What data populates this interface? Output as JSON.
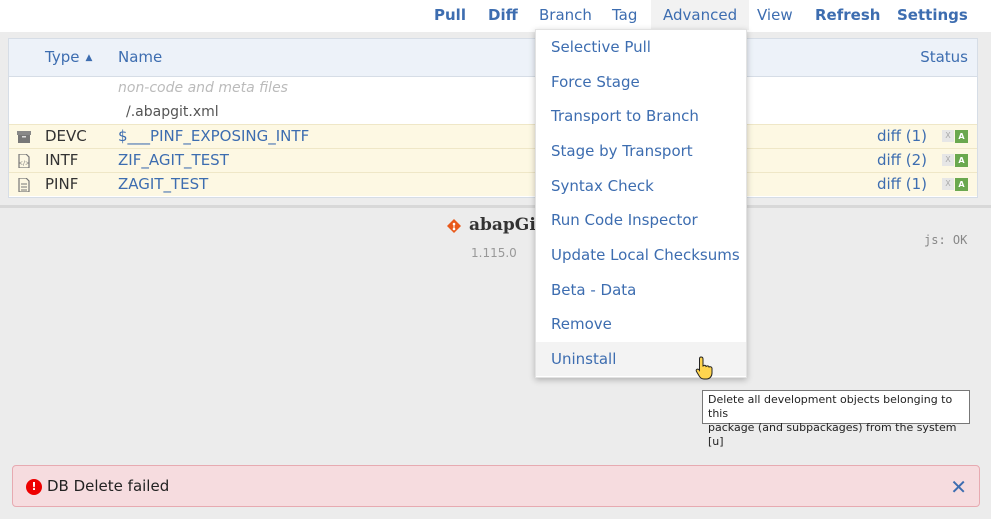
{
  "topnav": {
    "pull": "Pull",
    "diff": "Diff",
    "branch": "Branch",
    "tag": "Tag",
    "advanced": "Advanced",
    "view": "View",
    "refresh": "Refresh",
    "settings": "Settings"
  },
  "table": {
    "headers": {
      "type": "Type",
      "sort_indicator": "▲",
      "name": "Name",
      "status": "Status"
    },
    "meta": {
      "label": "non-code and meta files",
      "file": "/.abapgit.xml"
    },
    "rows": [
      {
        "icon": "package-icon",
        "type": "DEVC",
        "name": "$___PINF_EXPOSING_INTF",
        "diff": "diff (1)",
        "badge_x": "X",
        "badge_a": "A"
      },
      {
        "icon": "code-file-icon",
        "type": "INTF",
        "name": "ZIF_AGIT_TEST",
        "diff": "diff (2)",
        "badge_x": "X",
        "badge_a": "A"
      },
      {
        "icon": "document-icon",
        "type": "PINF",
        "name": "ZAGIT_TEST",
        "diff": "diff (1)",
        "badge_x": "X",
        "badge_a": "A"
      }
    ]
  },
  "advanced_menu": {
    "items": [
      "Selective Pull",
      "Force Stage",
      "Transport to Branch",
      "Stage by Transport",
      "Syntax Check",
      "Run Code Inspector",
      "Update Local Checksums",
      "Beta - Data",
      "Remove",
      "Uninstall"
    ],
    "hovered": "Uninstall"
  },
  "tooltip": {
    "line1": "Delete all development objects belonging to this",
    "line2": "package (and subpackages) from the system [u]"
  },
  "footer": {
    "logo_text": "abapGit",
    "version": "1.115.0",
    "js_status": "js: OK"
  },
  "error": {
    "message": "DB Delete failed",
    "icon": "!",
    "close": "✕"
  },
  "colors": {
    "link": "#3d6db0",
    "row_highlight": "#fdf8e3",
    "error_bg": "#f6dcdf",
    "badge_green": "#6aa84f",
    "logo_orange": "#e8591a"
  }
}
